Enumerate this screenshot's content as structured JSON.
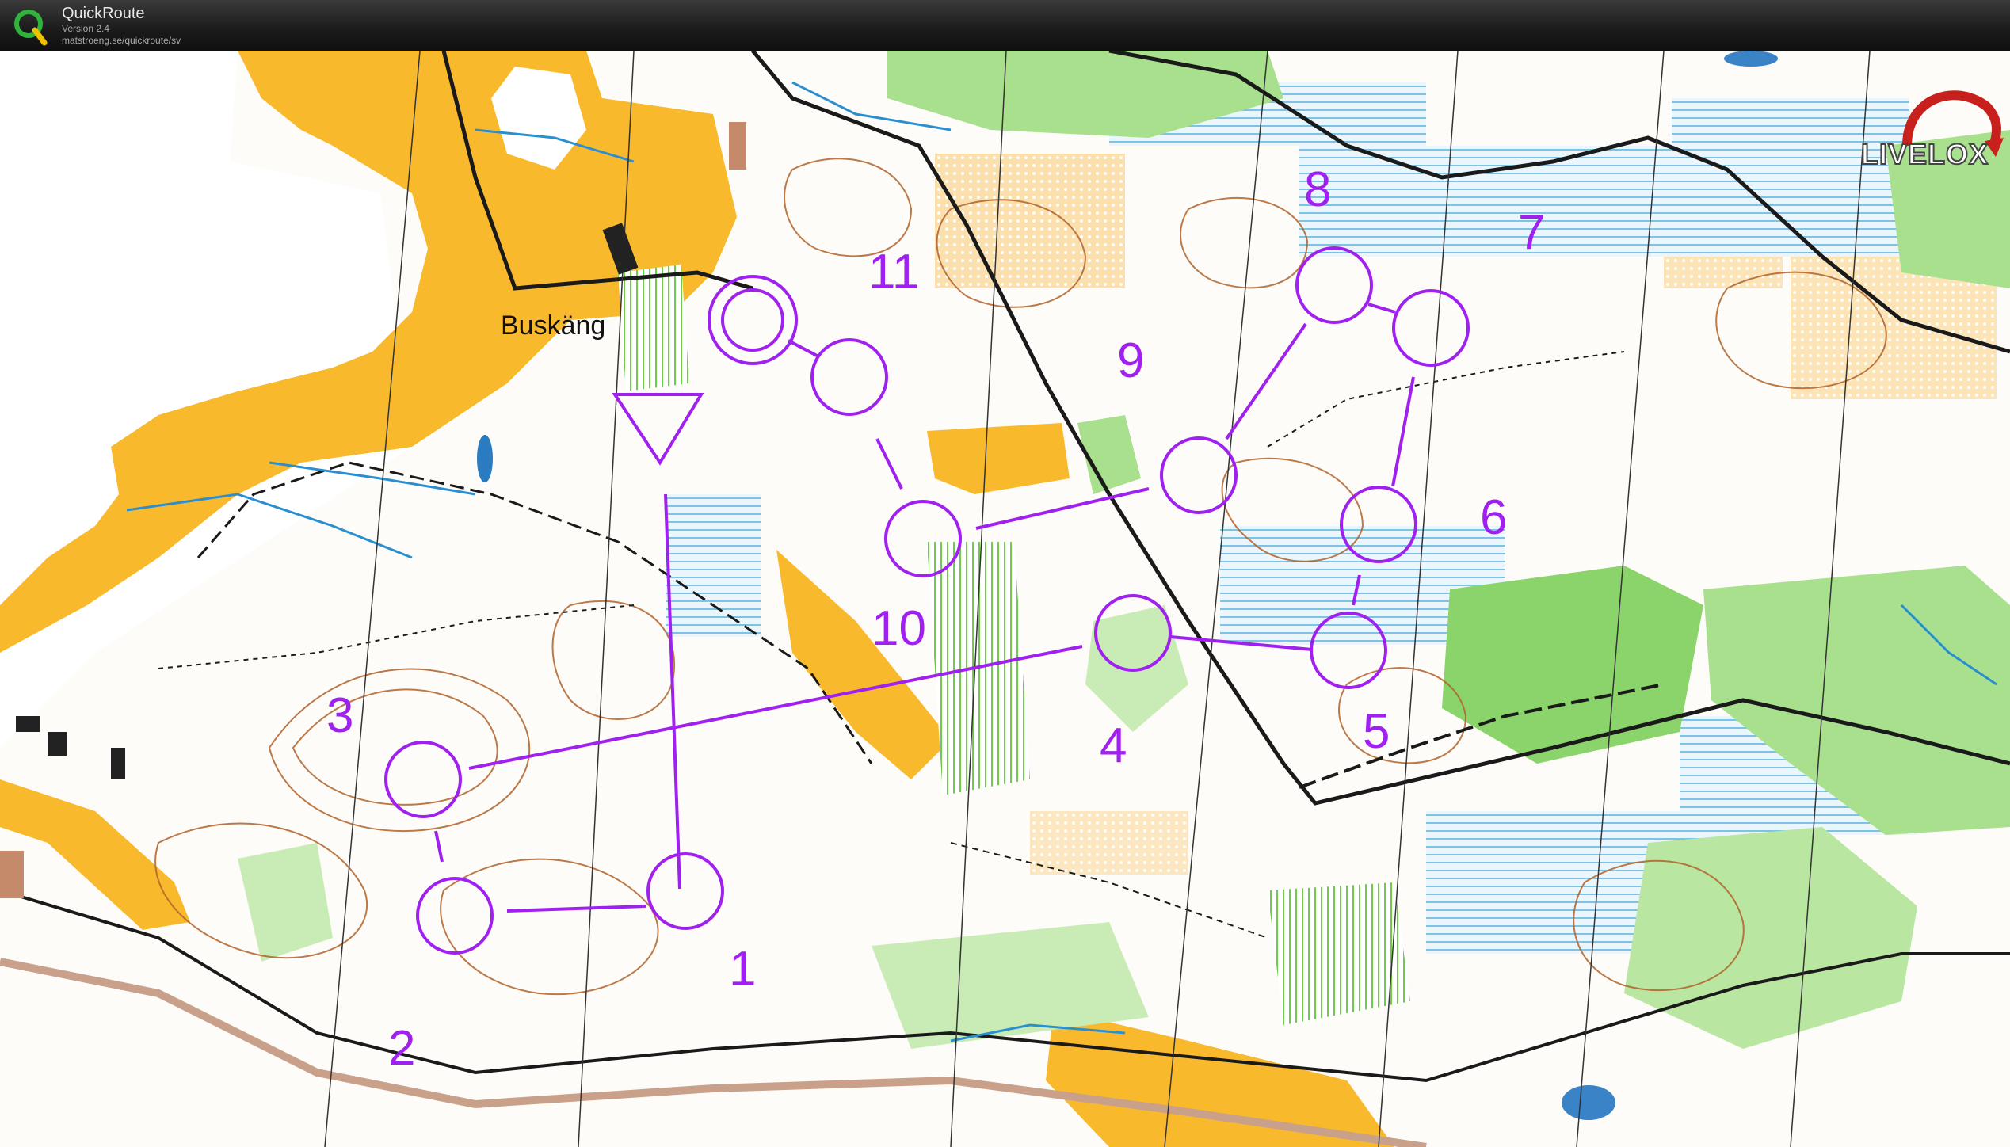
{
  "app": {
    "title": "QuickRoute",
    "version": "Version 2.4",
    "url": "matstroeng.se/quickroute/sv",
    "logo_icon": "quickroute-q-logo"
  },
  "map": {
    "place_name": "Buskäng",
    "brand_logo": "LIVELOX",
    "course_color": "#a020f0",
    "controls": [
      {
        "number": "1"
      },
      {
        "number": "2"
      },
      {
        "number": "3"
      },
      {
        "number": "4"
      },
      {
        "number": "5"
      },
      {
        "number": "6"
      },
      {
        "number": "7"
      },
      {
        "number": "8"
      },
      {
        "number": "9"
      },
      {
        "number": "10"
      },
      {
        "number": "11"
      }
    ]
  }
}
